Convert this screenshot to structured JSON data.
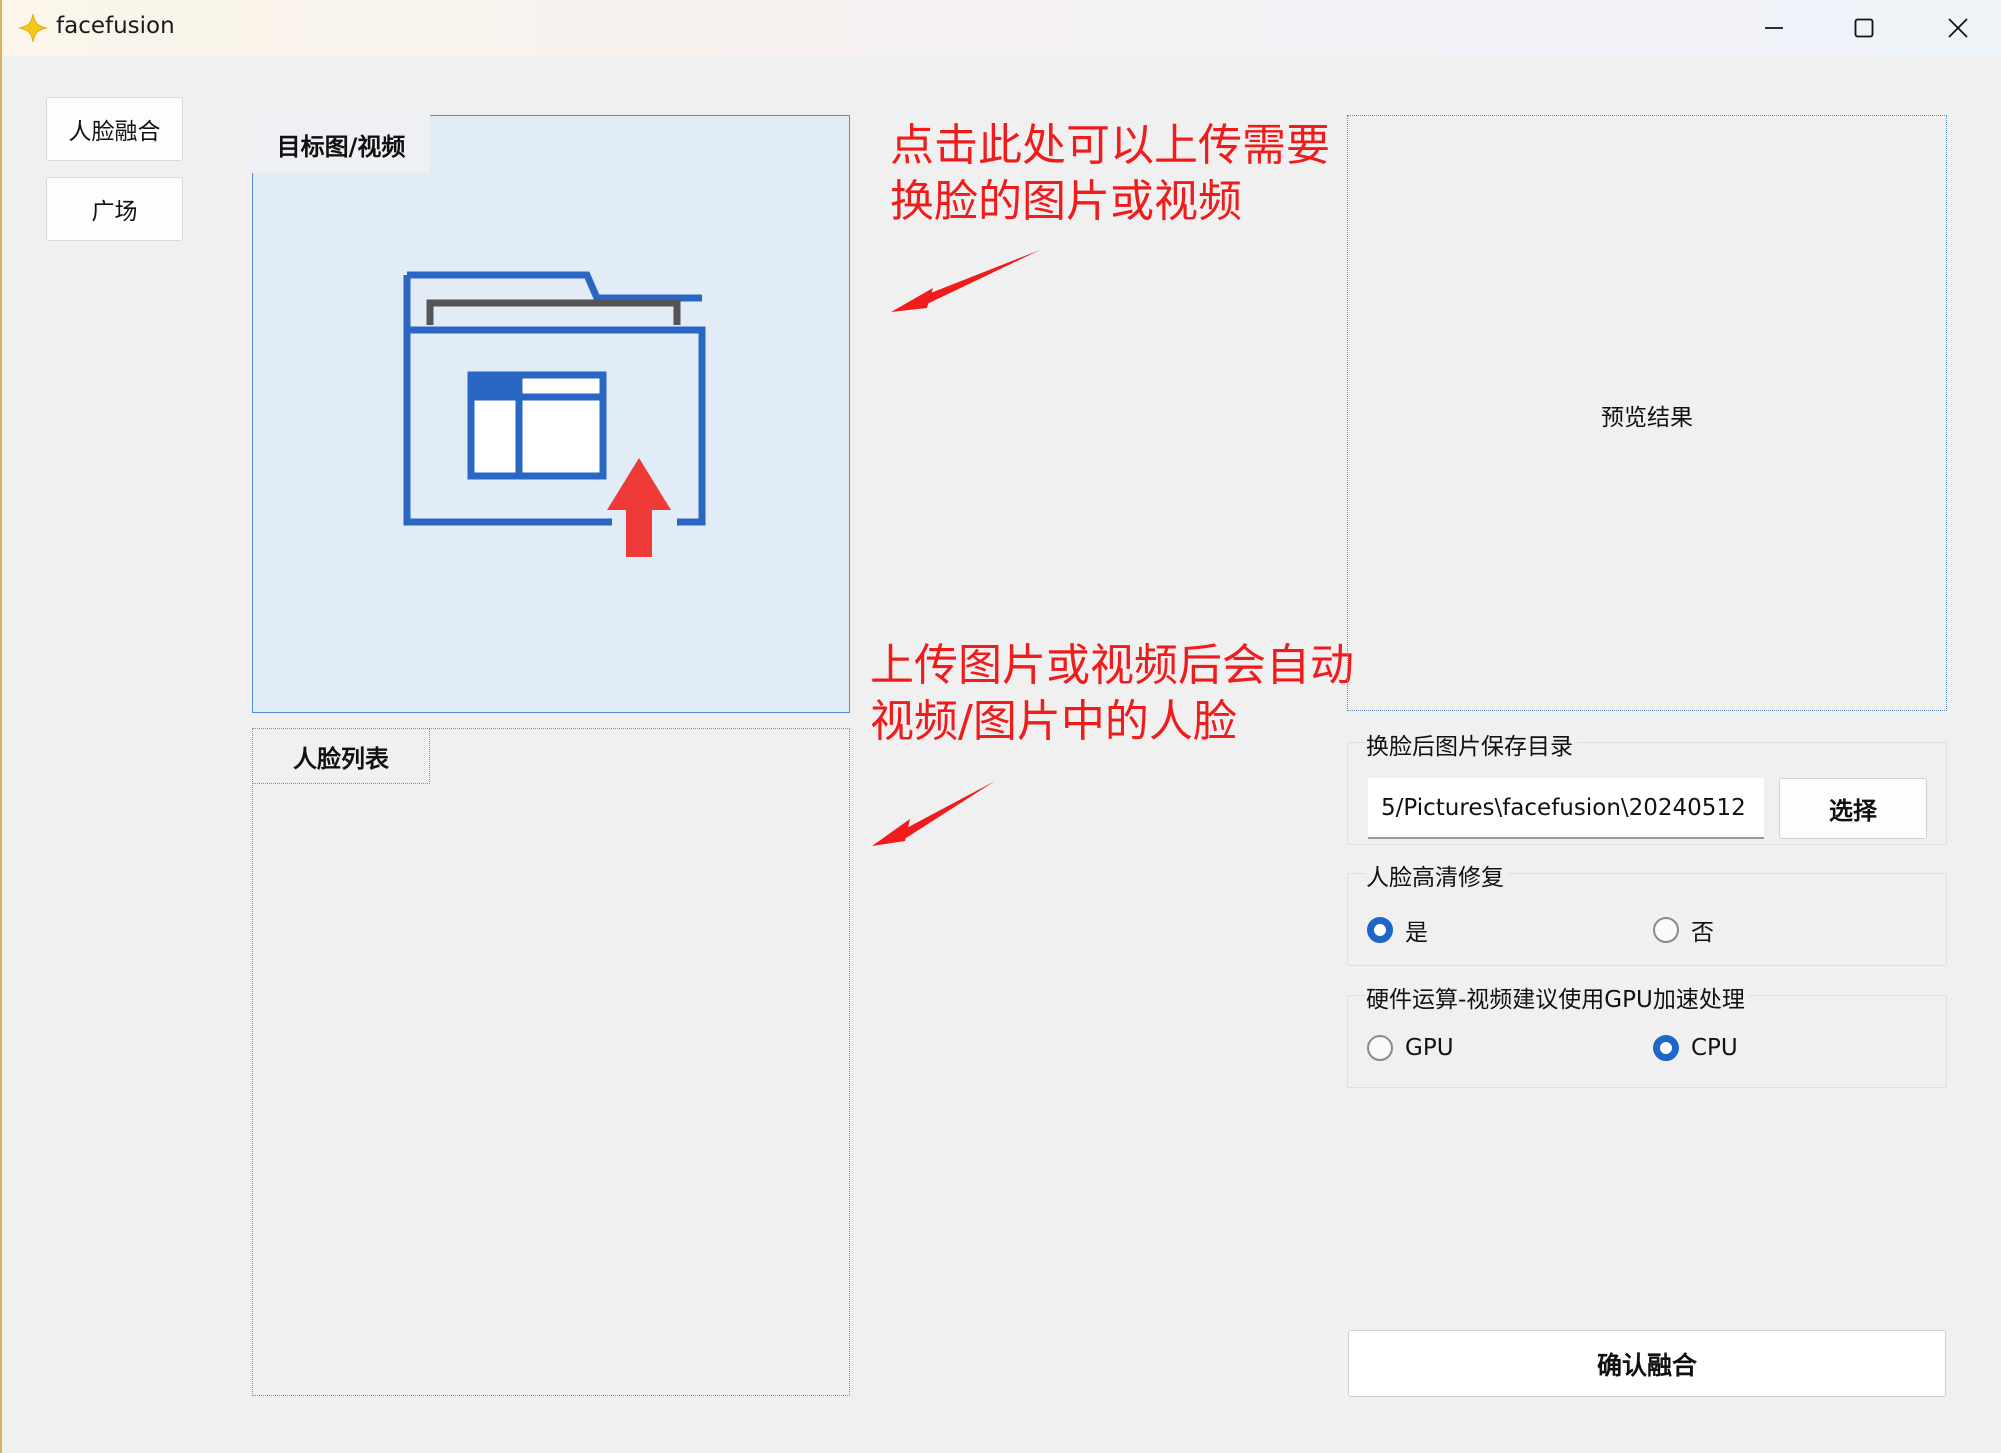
{
  "window": {
    "title": "facefusion"
  },
  "nav": {
    "face_fusion": "人脸融合",
    "square": "广场"
  },
  "target": {
    "title": "目标图/视频"
  },
  "face_list": {
    "title": "人脸列表"
  },
  "annotations": {
    "upload_line1": "点击此处可以上传需要",
    "upload_line2": "换脸的图片或视频",
    "detect_line1": "上传图片或视频后会自动",
    "detect_line2": "视频/图片中的人脸"
  },
  "preview": {
    "label": "预览结果"
  },
  "save_dir": {
    "label": "换脸后图片保存目录",
    "value": "5/Pictures\\facefusion\\20240512",
    "select_label": "选择"
  },
  "repair": {
    "label": "人脸高清修复",
    "options": [
      "是",
      "否"
    ],
    "selected": "是"
  },
  "hardware": {
    "label": "硬件运算-视频建议使用GPU加速处理",
    "options": [
      "GPU",
      "CPU"
    ],
    "selected": "CPU"
  },
  "confirm": {
    "label": "确认融合"
  },
  "colors": {
    "accent": "#1e66c8",
    "annotation": "#f01c1c",
    "target_bg": "#e1ecf7"
  }
}
